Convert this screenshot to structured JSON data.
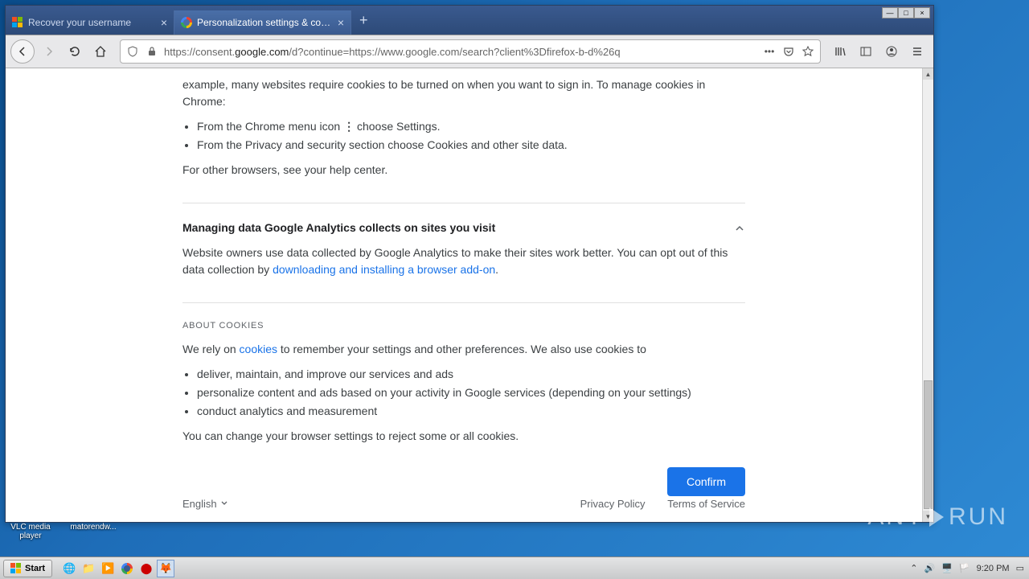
{
  "tabs": [
    {
      "title": "Recover your username"
    },
    {
      "title": "Personalization settings & cookies"
    }
  ],
  "url": {
    "prefix": "https://consent.",
    "domain": "google.com",
    "suffix": "/d?continue=https://www.google.com/search?client%3Dfirefox-b-d%26q"
  },
  "content": {
    "intro_partial": "example, many websites require cookies to be turned on when you want to sign in. To manage cookies in Chrome:",
    "chrome_li1_a": "From the Chrome menu icon ",
    "chrome_li1_b": " choose Settings.",
    "chrome_li2": "From the Privacy and security section choose Cookies and other site data.",
    "other_browsers": "For other browsers, see your help center.",
    "analytics_heading": "Managing data Google Analytics collects on sites you visit",
    "analytics_body_a": "Website owners use data collected by Google Analytics to make their sites work better. You can opt out of this data collection by ",
    "analytics_link": "downloading and installing a browser add-on",
    "about_label": "ABOUT COOKIES",
    "about_body_a": "We rely on ",
    "about_link": "cookies",
    "about_body_b": " to remember your settings and other preferences. We also use cookies to",
    "about_li1": "deliver, maintain, and improve our services and ads",
    "about_li2": "personalize content and ads based on your activity in Google services (depending on your settings)",
    "about_li3": "conduct analytics and measurement",
    "about_close": "You can change your browser settings to reject some or all cookies.",
    "confirm": "Confirm",
    "language": "English",
    "privacy": "Privacy Policy",
    "terms": "Terms of Service"
  },
  "desktop": {
    "icon1": "VLC media player",
    "icon2": "matorendw..."
  },
  "taskbar": {
    "start": "Start",
    "time": "9:20 PM"
  },
  "watermark_a": "ANY",
  "watermark_b": "RUN"
}
